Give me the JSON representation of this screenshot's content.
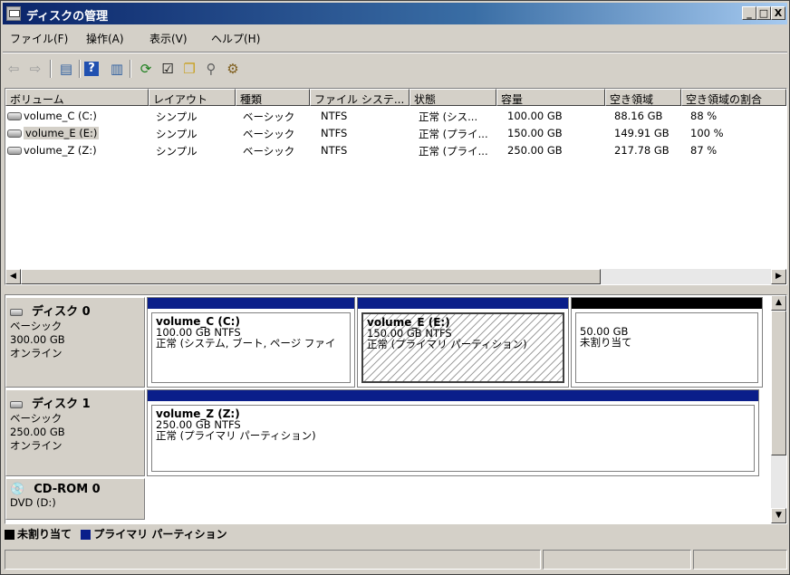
{
  "window": {
    "title": "ディスクの管理",
    "minimize": "_",
    "maximize": "□",
    "close": "X"
  },
  "menu": [
    "ファイル(F)",
    "操作(A)",
    "表示(V)",
    "ヘルプ(H)"
  ],
  "toolbar": [
    "back-icon",
    "forward-icon",
    "disk-view-icon",
    "help-icon",
    "list-view-icon",
    "refresh-icon",
    "properties-icon",
    "open-icon",
    "search-icon",
    "settings-icon"
  ],
  "list": {
    "columns": [
      "ボリューム",
      "レイアウト",
      "種類",
      "ファイル システ...",
      "状態",
      "容量",
      "空き領域",
      "空き領域の割合"
    ],
    "rows": [
      {
        "volume": "volume_C (C:)",
        "layout": "シンプル",
        "type": "ベーシック",
        "fs": "NTFS",
        "status": "正常 (シス...",
        "capacity": "100.00 GB",
        "free": "88.16 GB",
        "pct": "88 %"
      },
      {
        "volume": "volume_E (E:)",
        "layout": "シンプル",
        "type": "ベーシック",
        "fs": "NTFS",
        "status": "正常 (プライ...",
        "capacity": "150.00 GB",
        "free": "149.91 GB",
        "pct": "100 %"
      },
      {
        "volume": "volume_Z (Z:)",
        "layout": "シンプル",
        "type": "ベーシック",
        "fs": "NTFS",
        "status": "正常 (プライ...",
        "capacity": "250.00 GB",
        "free": "217.78 GB",
        "pct": "87 %"
      }
    ]
  },
  "disks": [
    {
      "name": "ディスク 0",
      "type": "ベーシック",
      "size": "300.00 GB",
      "state": "オンライン",
      "partitions": [
        {
          "name": "volume_C  (C:)",
          "size": "100.00 GB NTFS",
          "status": "正常 (システム, ブート, ページ ファイ"
        },
        {
          "name": "volume_E  (E:)",
          "size": "150.00 GB NTFS",
          "status": "正常 (プライマリ パーティション)"
        },
        {
          "size": "50.00 GB",
          "status": "未割り当て"
        }
      ]
    },
    {
      "name": "ディスク 1",
      "type": "ベーシック",
      "size": "250.00 GB",
      "state": "オンライン",
      "partitions": [
        {
          "name": "volume_Z  (Z:)",
          "size": "250.00 GB NTFS",
          "status": "正常 (プライマリ パーティション)"
        }
      ]
    },
    {
      "name": "CD-ROM 0",
      "type": "DVD (D:)"
    }
  ],
  "legend": {
    "unallocated": "未割り当て",
    "primary": "プライマリ パーティション",
    "unallocated_color": "#000000",
    "primary_color": "#0a1e8a"
  },
  "colors": {
    "primary_bar": "#0a1e8a",
    "unallocated_bar": "#000000",
    "selected_row": "#d4d0c8"
  }
}
